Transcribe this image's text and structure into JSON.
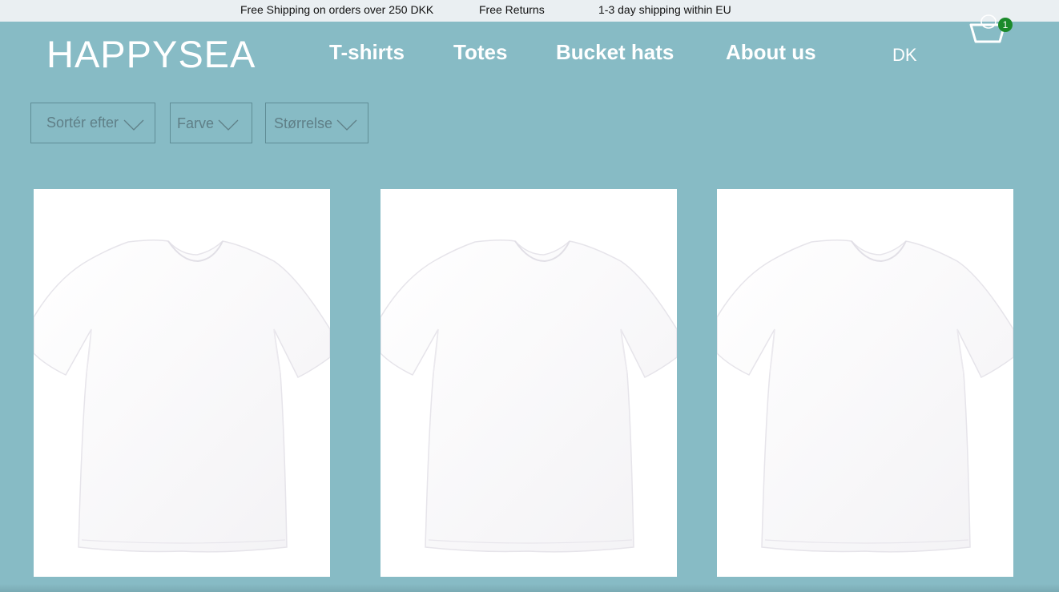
{
  "announcement_bar": [
    "Free Shipping on orders over 250 DKK",
    "Free Returns",
    "1-3 day shipping within EU"
  ],
  "header": {
    "logo": "HAPPYSEA",
    "nav": [
      "T-shirts",
      "Totes",
      "Bucket hats",
      "About us"
    ],
    "language": "DK",
    "cart_count": "1",
    "cart_icon": "basket-icon"
  },
  "filters": [
    {
      "label": "Sortér efter",
      "icon": "chevron-down-icon"
    },
    {
      "label": "Farve",
      "icon": "chevron-down-icon"
    },
    {
      "label": "Størrelse",
      "icon": "chevron-down-icon"
    }
  ],
  "products": [
    {
      "image": "white-tshirt"
    },
    {
      "image": "white-tshirt"
    },
    {
      "image": "white-tshirt"
    }
  ],
  "colors": {
    "background": "#87bbc5",
    "announcement_bg": "#eaeff2",
    "badge": "#1b8a2a"
  }
}
